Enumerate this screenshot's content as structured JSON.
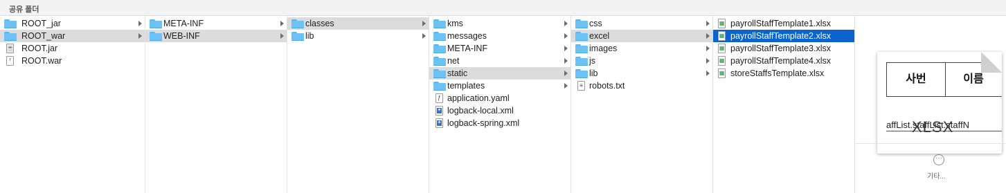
{
  "header": {
    "title": "공유 폴더"
  },
  "columns": [
    {
      "items": [
        {
          "label": "ROOT_jar",
          "icon": "folder-icon"
        },
        {
          "label": "ROOT_war",
          "icon": "folder-icon"
        },
        {
          "label": "ROOT.jar",
          "icon": "jar-file-icon"
        },
        {
          "label": "ROOT.war",
          "icon": "file-icon"
        }
      ]
    },
    {
      "items": [
        {
          "label": "META-INF",
          "icon": "folder-icon"
        },
        {
          "label": "WEB-INF",
          "icon": "folder-icon"
        }
      ]
    },
    {
      "items": [
        {
          "label": "classes",
          "icon": "folder-icon"
        },
        {
          "label": "lib",
          "icon": "folder-icon"
        }
      ]
    },
    {
      "items": [
        {
          "label": "kms",
          "icon": "folder-icon"
        },
        {
          "label": "messages",
          "icon": "folder-icon"
        },
        {
          "label": "META-INF",
          "icon": "folder-icon"
        },
        {
          "label": "net",
          "icon": "folder-icon"
        },
        {
          "label": "static",
          "icon": "folder-icon"
        },
        {
          "label": "templates",
          "icon": "folder-icon"
        },
        {
          "label": "application.yaml",
          "icon": "yaml-file-icon"
        },
        {
          "label": "logback-local.xml",
          "icon": "xml-file-icon"
        },
        {
          "label": "logback-spring.xml",
          "icon": "xml-file-icon"
        }
      ]
    },
    {
      "items": [
        {
          "label": "css",
          "icon": "folder-icon"
        },
        {
          "label": "excel",
          "icon": "folder-icon"
        },
        {
          "label": "images",
          "icon": "folder-icon"
        },
        {
          "label": "js",
          "icon": "folder-icon"
        },
        {
          "label": "lib",
          "icon": "folder-icon"
        },
        {
          "label": "robots.txt",
          "icon": "text-file-icon"
        }
      ]
    },
    {
      "items": [
        {
          "label": "payrollStaffTemplate1.xlsx",
          "icon": "xlsx-file-icon"
        },
        {
          "label": "payrollStaffTemplate2.xlsx",
          "icon": "xlsx-file-icon"
        },
        {
          "label": "payrollStaffTemplate3.xlsx",
          "icon": "xlsx-file-icon"
        },
        {
          "label": "payrollStaffTemplate4.xlsx",
          "icon": "xlsx-file-icon"
        },
        {
          "label": "storeStaffsTemplate.xlsx",
          "icon": "xlsx-file-icon"
        }
      ]
    }
  ],
  "preview": {
    "cell1": "사번",
    "cell2": "이름",
    "code_text": "affList.staffList.staffN",
    "file_kind": "XLSX",
    "more_symbol": "···",
    "more_label": "기타..."
  },
  "colors": {
    "selection_blue": "#0b63ce",
    "selection_gray": "#dcdcdc",
    "folder": "#6cc2f4"
  }
}
